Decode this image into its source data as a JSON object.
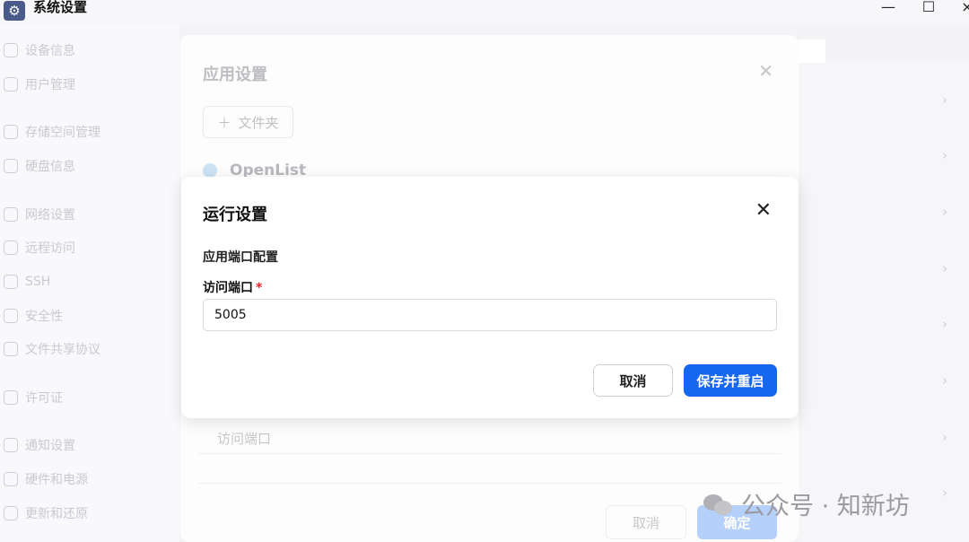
{
  "window": {
    "title": "系统设置",
    "app_icon": "gear-icon",
    "controls": {
      "minimize": "—",
      "maximize": "☐",
      "close": "×"
    }
  },
  "sidebar": {
    "items": [
      {
        "label": "设备信息",
        "icon": "device-icon"
      },
      {
        "label": "用户管理",
        "icon": "user-icon"
      },
      {
        "label": "存储空间管理",
        "icon": "storage-icon"
      },
      {
        "label": "硬盘信息",
        "icon": "disk-icon"
      },
      {
        "label": "网络设置",
        "icon": "network-icon"
      },
      {
        "label": "远程访问",
        "icon": "remote-icon"
      },
      {
        "label": "SSH",
        "icon": "ssh-icon"
      },
      {
        "label": "安全性",
        "icon": "security-icon"
      },
      {
        "label": "文件共享协议",
        "icon": "file-share-icon"
      },
      {
        "label": "许可证",
        "icon": "license-icon"
      },
      {
        "label": "通知设置",
        "icon": "notification-icon"
      },
      {
        "label": "硬件和电源",
        "icon": "hardware-icon"
      },
      {
        "label": "更新和还原",
        "icon": "update-icon"
      }
    ]
  },
  "app_settings_dialog": {
    "title": "应用设置",
    "add_folder_label": "文件夹",
    "app_name": "OpenList",
    "port_label": "访问端口",
    "cancel_label": "取消",
    "confirm_label": "确定"
  },
  "run_settings_modal": {
    "title": "运行设置",
    "section_label": "应用端口配置",
    "port_field_label": "访问端口",
    "required_mark": "*",
    "port_value": "5005",
    "cancel_label": "取消",
    "save_label": "保存并重启"
  },
  "watermark": {
    "text": "公众号 · 知新坊"
  },
  "colors": {
    "primary": "#1566f0",
    "required": "#e0262a"
  }
}
